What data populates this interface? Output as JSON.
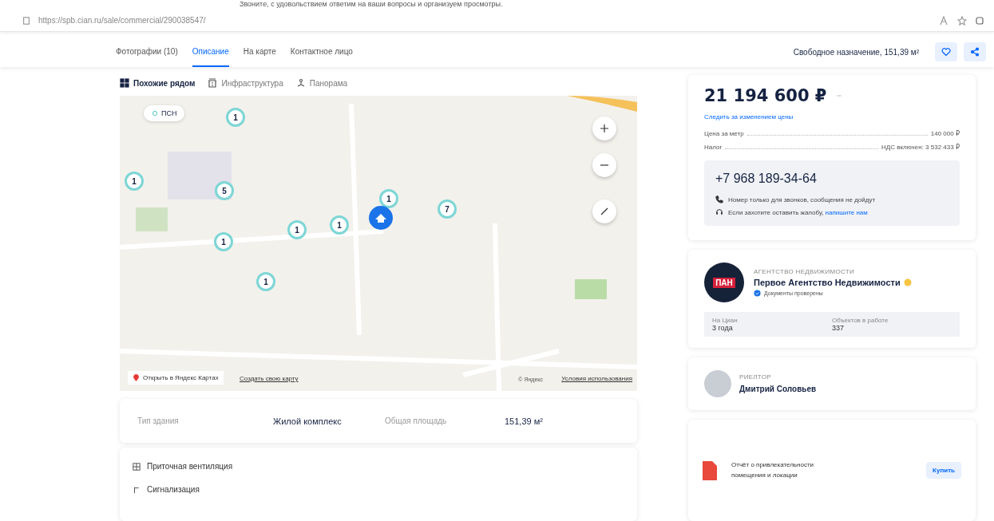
{
  "top_text": "Звоните, с удовольствием ответим на ваши вопросы и организуем просмотры.",
  "browser": {
    "url": "https://spb.cian.ru/sale/commercial/290038547/"
  },
  "nav": {
    "tabs": [
      {
        "label": "Фотографии (10)",
        "selected": false
      },
      {
        "label": "Описание",
        "selected": true
      },
      {
        "label": "На карте",
        "selected": false
      },
      {
        "label": "Контактное лицо",
        "selected": false
      }
    ],
    "summary": "Свободное назначение, 151,39 м²"
  },
  "map_tabs": [
    {
      "label": "Похожие рядом",
      "kind": "grid",
      "selected": true
    },
    {
      "label": "Инфраструктура",
      "kind": "building",
      "selected": false
    },
    {
      "label": "Панорама",
      "kind": "person",
      "selected": false
    }
  ],
  "map": {
    "filter_chip": "ПСН",
    "clusters": [
      {
        "count": "1"
      },
      {
        "count": "1"
      },
      {
        "count": "5"
      },
      {
        "count": "1"
      },
      {
        "count": "7"
      },
      {
        "count": "1"
      },
      {
        "count": "1"
      },
      {
        "count": "1"
      },
      {
        "count": "1"
      }
    ],
    "open_link": "Открыть в Яндекс Картах",
    "create_link": "Создать свою карту",
    "copyright": "© Яндекс",
    "terms": "Условия использования"
  },
  "facts": [
    {
      "label": "Тип здания",
      "value": "Жилой комплекс"
    },
    {
      "label": "Общая площадь",
      "value": "151,39 м²"
    }
  ],
  "features": [
    {
      "kind": "ventilation",
      "label": "Приточная вентиляция"
    },
    {
      "kind": "alarm",
      "label": "Сигнализация"
    }
  ],
  "price": {
    "value": "21 194 600 ₽",
    "watch": "Следить за изменением цены",
    "rows": [
      {
        "label": "Цена за метр",
        "value": "140 000 ₽"
      },
      {
        "label": "Налог",
        "value": "НДС включен: 3 532 433 ₽"
      }
    ]
  },
  "phone": {
    "number": "+7 968 189-34-64",
    "notes": [
      {
        "kind": "phone",
        "text": "Номер только для звонков, сообщения не дойдут"
      },
      {
        "kind": "complaint",
        "text": "Если захотите оставить жалобу,",
        "link": "напишите нам"
      }
    ]
  },
  "agency": {
    "caption": "АГЕНТСТВО НЕДВИЖИМОСТИ",
    "logo": "ПАН",
    "name": "Первое Агентство Недвижимости",
    "verified": "Документы проверены",
    "stats": [
      {
        "label": "На Циан",
        "value": "3 года"
      },
      {
        "label": "Объектов в работе",
        "value": "337"
      }
    ]
  },
  "realtor": {
    "caption": "РИЕЛТОР",
    "name": "Дмитрий Соловьев"
  },
  "report": {
    "text": "Отчёт о привлекательности помещения и локации",
    "button": "Купить"
  }
}
